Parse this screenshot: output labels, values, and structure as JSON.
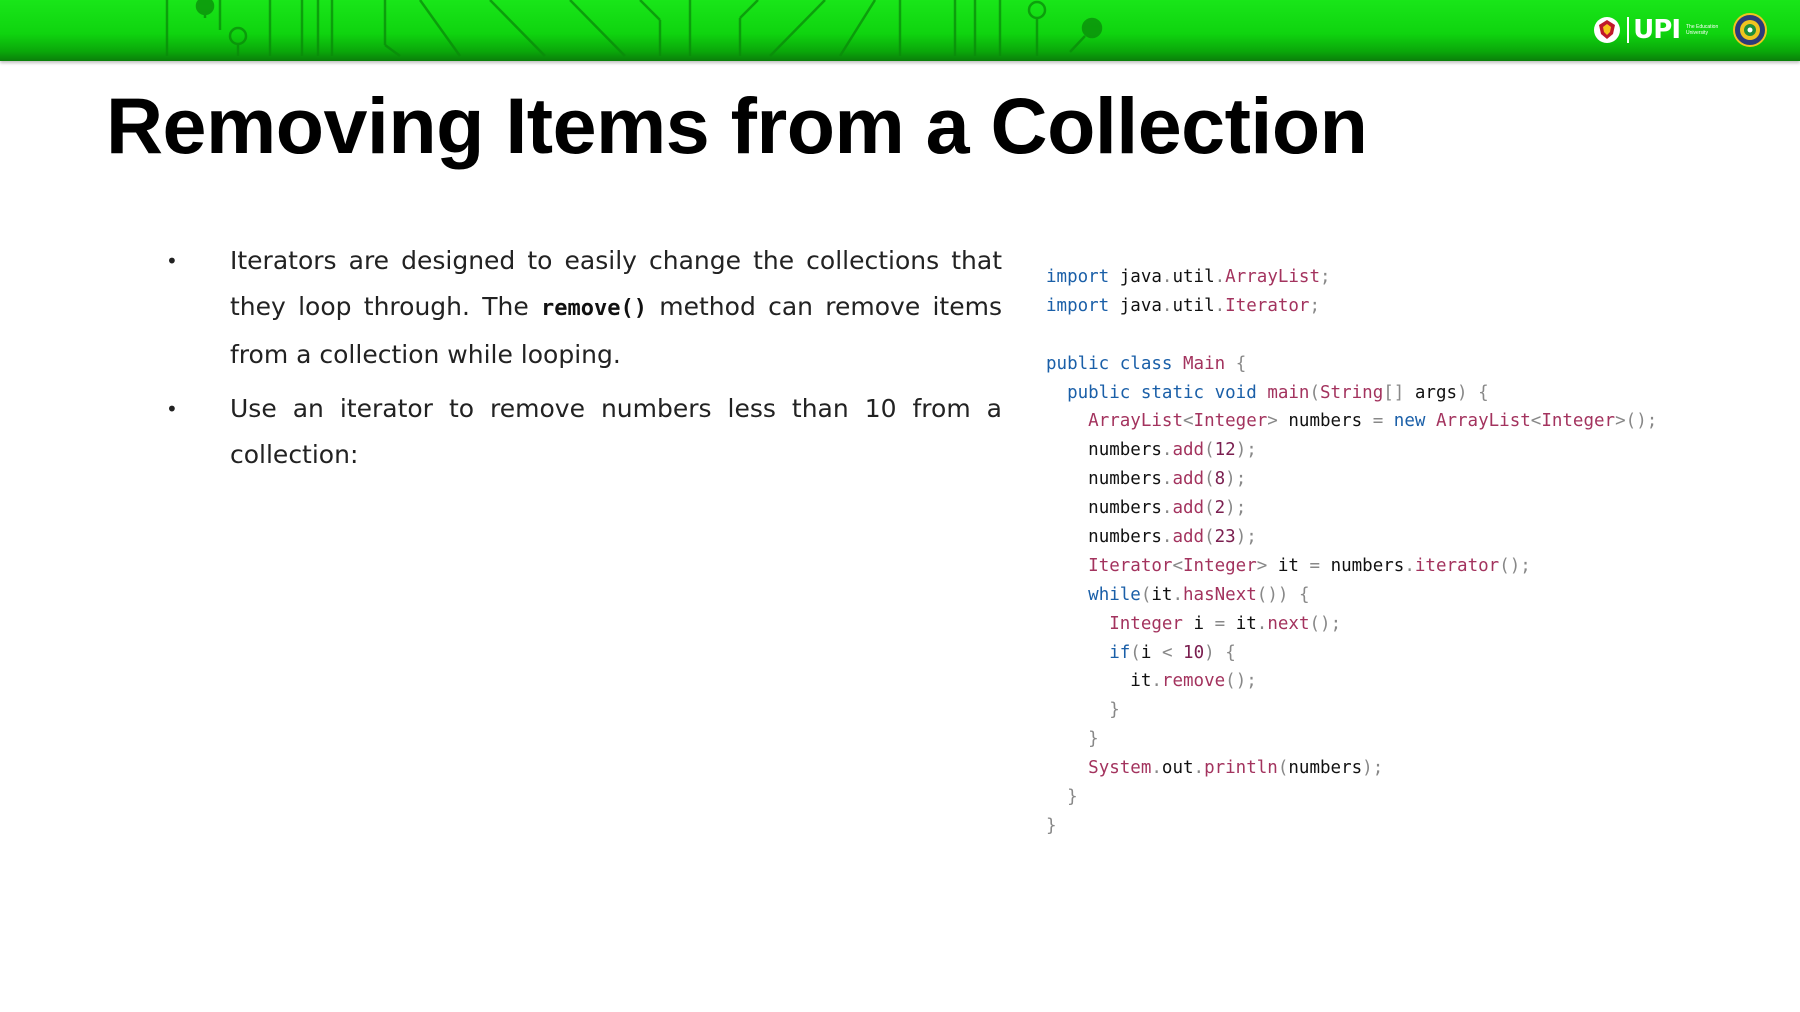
{
  "slide": {
    "title": "Removing Items from a Collection",
    "logo": {
      "brand": "UPI",
      "tagline": "The Education University",
      "icons": [
        "upi-emblem-icon",
        "university-seal-icon"
      ]
    },
    "colors": {
      "banner": "#0fd40f",
      "keyword": "#1a5fa8",
      "type": "#a3335e"
    }
  },
  "bullets": [
    {
      "pre": "Iterators are designed to easily change the collections that they loop through. The ",
      "code": "remove()",
      "post": " method can remove items from a collection while looping."
    },
    {
      "text": "Use an iterator to remove numbers less than 10 from a collection:"
    }
  ],
  "code_lines": [
    "import java.util.ArrayList;",
    "import java.util.Iterator;",
    "",
    "public class Main {",
    "  public static void main(String[] args) {",
    "    ArrayList<Integer> numbers = new ArrayList<Integer>();",
    "    numbers.add(12);",
    "    numbers.add(8);",
    "    numbers.add(2);",
    "    numbers.add(23);",
    "    Iterator<Integer> it = numbers.iterator();",
    "    while(it.hasNext()) {",
    "      Integer i = it.next();",
    "      if(i < 10) {",
    "        it.remove();",
    "      }",
    "    }",
    "    System.out.println(numbers);",
    "  }",
    "}"
  ]
}
